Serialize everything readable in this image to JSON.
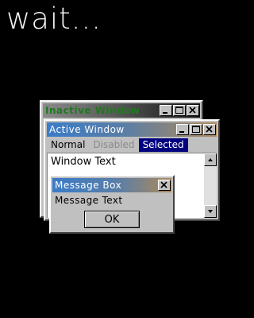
{
  "screen": {
    "wait_text": "wait..."
  },
  "inactive_window": {
    "title": "Inactive Window",
    "title_color": "#1d7a1d",
    "buttons": [
      "minimize-icon",
      "maximize-icon",
      "close-icon"
    ]
  },
  "active_window": {
    "title": "Active Window",
    "buttons": [
      "minimize-icon",
      "maximize-icon",
      "close-icon"
    ],
    "menu": {
      "normal": "Normal",
      "disabled": "Disabled",
      "selected": "Selected"
    },
    "selected_color": "#000080",
    "client_text": "Window Text",
    "scrollbar": {
      "up": "arrow-up-icon",
      "down": "arrow-down-icon"
    }
  },
  "message_box": {
    "title": "Message Box",
    "message": "Message Text",
    "ok_label": "OK"
  }
}
